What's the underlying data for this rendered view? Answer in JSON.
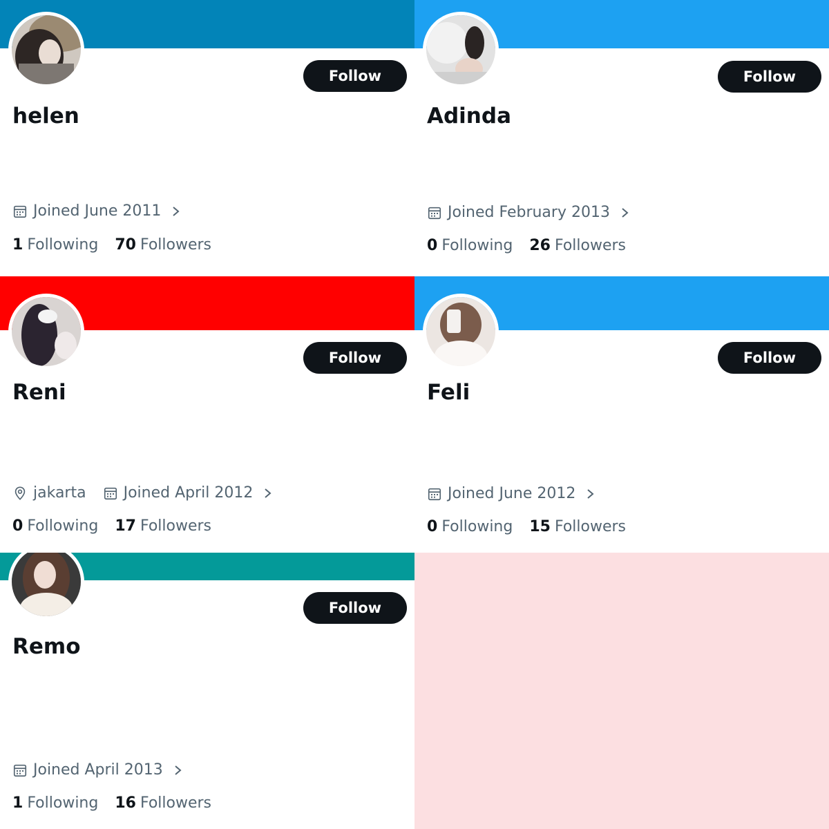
{
  "cards": [
    {
      "name": "helen",
      "banner_color": "#0284b8",
      "follow_label": "Follow",
      "location": "",
      "joined": "Joined June 2011",
      "following_count": "1",
      "following_label": "Following",
      "followers_count": "70",
      "followers_label": "Followers"
    },
    {
      "name": "Adinda",
      "banner_color": "#1da1f2",
      "follow_label": "Follow",
      "location": "",
      "joined": "Joined February 2013",
      "following_count": "0",
      "following_label": "Following",
      "followers_count": "26",
      "followers_label": "Followers"
    },
    {
      "name": "Reni",
      "banner_color": "#ff0000",
      "follow_label": "Follow",
      "location": "jakarta",
      "joined": "Joined April 2012",
      "following_count": "0",
      "following_label": "Following",
      "followers_count": "17",
      "followers_label": "Followers"
    },
    {
      "name": "Feli",
      "banner_color": "#1da1f2",
      "follow_label": "Follow",
      "location": "",
      "joined": "Joined June 2012",
      "following_count": "0",
      "following_label": "Following",
      "followers_count": "15",
      "followers_label": "Followers"
    },
    {
      "name": "Remo",
      "banner_color": "#049a99",
      "follow_label": "Follow",
      "location": "",
      "joined": "Joined April 2013",
      "following_count": "1",
      "following_label": "Following",
      "followers_count": "16",
      "followers_label": "Followers"
    }
  ],
  "icons": {
    "calendar": "calendar-icon",
    "location": "location-pin-icon",
    "chevron": "chevron-right-icon"
  },
  "colors": {
    "button_bg": "#0f1419",
    "secondary_text": "#536471",
    "empty_panel": "#fcdfe1"
  }
}
